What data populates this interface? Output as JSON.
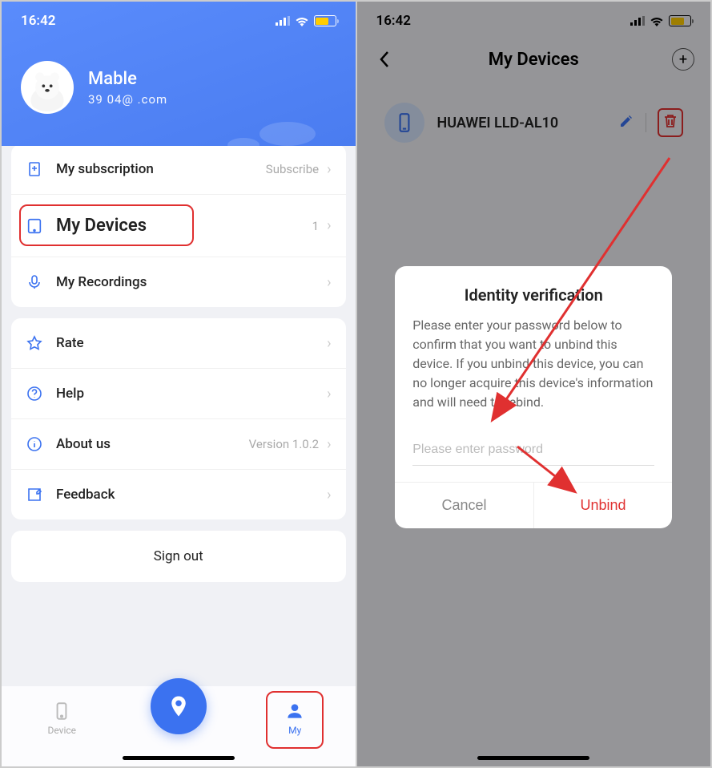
{
  "status": {
    "time": "16:42"
  },
  "profile": {
    "name": "Mable",
    "email": "39      04@    .com"
  },
  "menu": {
    "subscription": {
      "label": "My subscription",
      "extra": "Subscribe"
    },
    "devices": {
      "label": "My Devices",
      "count": "1"
    },
    "recordings": {
      "label": "My Recordings"
    },
    "rate": {
      "label": "Rate"
    },
    "help": {
      "label": "Help"
    },
    "about": {
      "label": "About us",
      "extra": "Version 1.0.2"
    },
    "feedback": {
      "label": "Feedback"
    },
    "signout": "Sign out"
  },
  "tabs": {
    "device": "Device",
    "my": "My"
  },
  "rightScreen": {
    "title": "My Devices",
    "device_name": "HUAWEI LLD-AL10"
  },
  "dialog": {
    "title": "Identity verification",
    "body": "Please enter your password below to confirm that you want to unbind this device. If you unbind this device, you can no longer acquire this device's information and will need to rebind.",
    "placeholder": "Please enter password",
    "cancel": "Cancel",
    "confirm": "Unbind"
  },
  "colors": {
    "primary": "#3b72f0",
    "danger": "#e03030",
    "battery": "#ffcc00"
  }
}
